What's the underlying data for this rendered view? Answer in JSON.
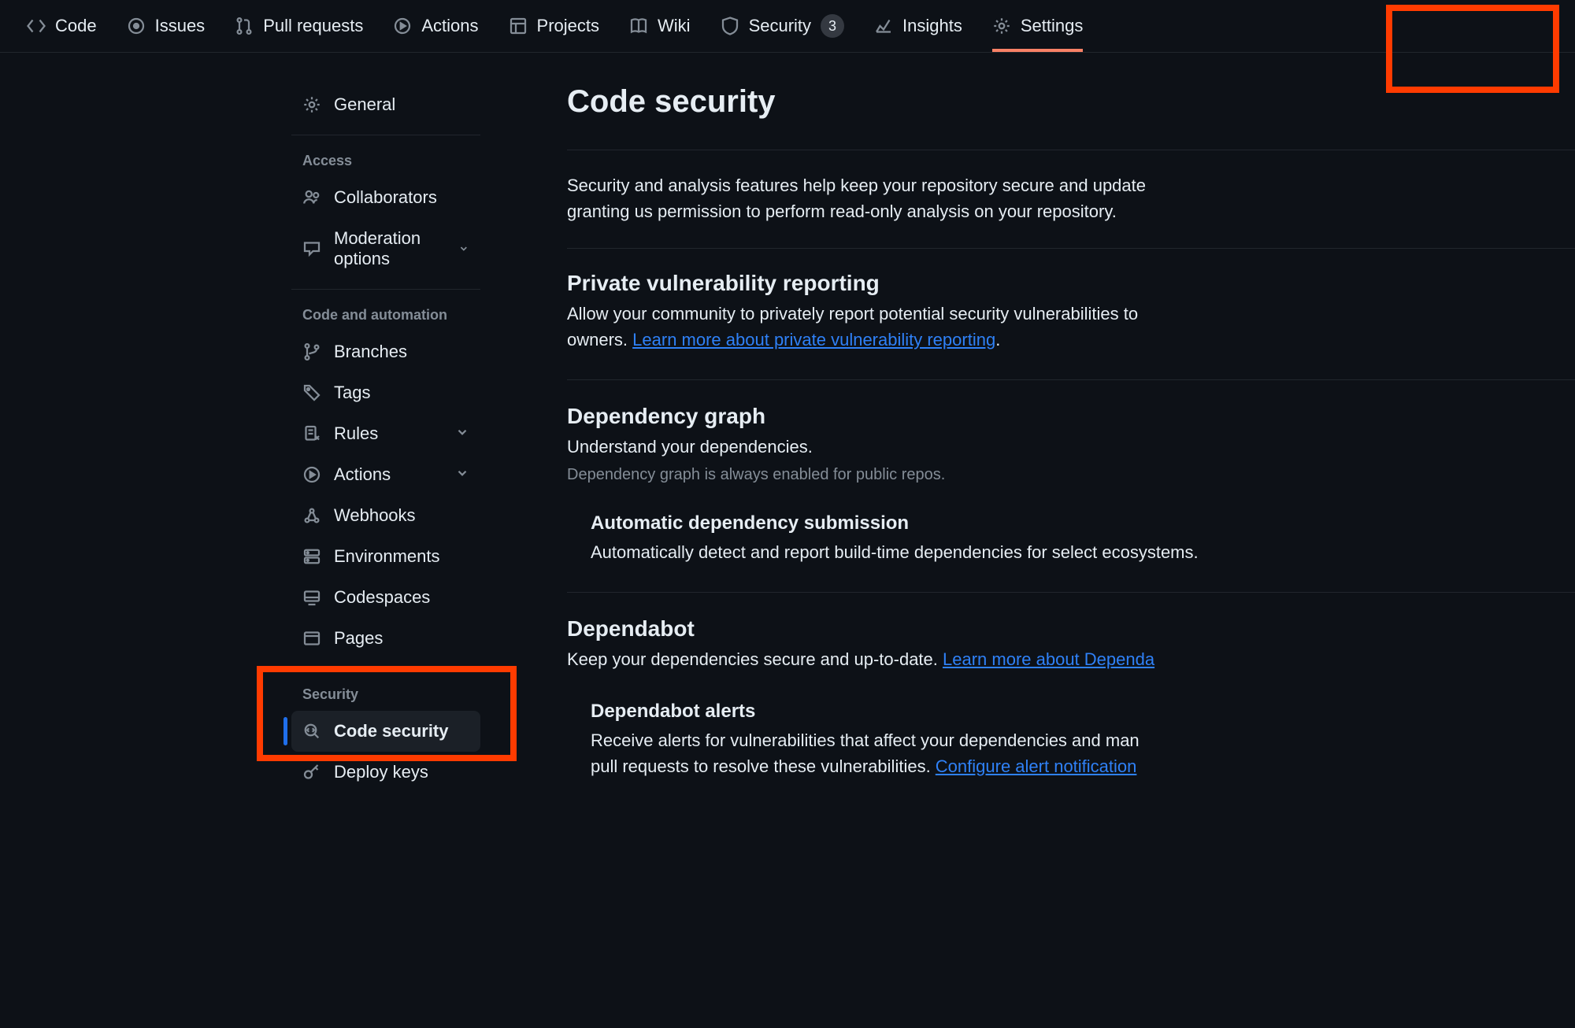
{
  "topnav": {
    "code": "Code",
    "issues": "Issues",
    "pulls": "Pull requests",
    "actions": "Actions",
    "projects": "Projects",
    "wiki": "Wiki",
    "security": "Security",
    "security_count": "3",
    "insights": "Insights",
    "settings": "Settings"
  },
  "sidebar": {
    "general": "General",
    "access_heading": "Access",
    "collaborators": "Collaborators",
    "moderation": "Moderation options",
    "code_auto_heading": "Code and automation",
    "branches": "Branches",
    "tags": "Tags",
    "rules": "Rules",
    "actions": "Actions",
    "webhooks": "Webhooks",
    "environments": "Environments",
    "codespaces": "Codespaces",
    "pages": "Pages",
    "security_heading": "Security",
    "code_security": "Code security",
    "deploy_keys": "Deploy keys"
  },
  "main": {
    "title": "Code security",
    "intro1": "Security and analysis features help keep your repository secure and update",
    "intro2": "granting us permission to perform read-only analysis on your repository.",
    "pvr": {
      "heading": "Private vulnerability reporting",
      "body1": "Allow your community to privately report potential security vulnerabilities to",
      "body2_prefix": "owners. ",
      "link": "Learn more about private vulnerability reporting",
      "body2_suffix": "."
    },
    "depgraph": {
      "heading": "Dependency graph",
      "body": "Understand your dependencies.",
      "note": "Dependency graph is always enabled for public repos."
    },
    "auto_sub": {
      "heading": "Automatic dependency submission",
      "body": "Automatically detect and report build-time dependencies for select ecosystems."
    },
    "dependabot": {
      "heading": "Dependabot",
      "body_prefix": "Keep your dependencies secure and up-to-date. ",
      "link": "Learn more about Dependa"
    },
    "alerts": {
      "heading": "Dependabot alerts",
      "body1": "Receive alerts for vulnerabilities that affect your dependencies and man",
      "body2_prefix": "pull requests to resolve these vulnerabilities. ",
      "link": "Configure alert notification"
    }
  }
}
